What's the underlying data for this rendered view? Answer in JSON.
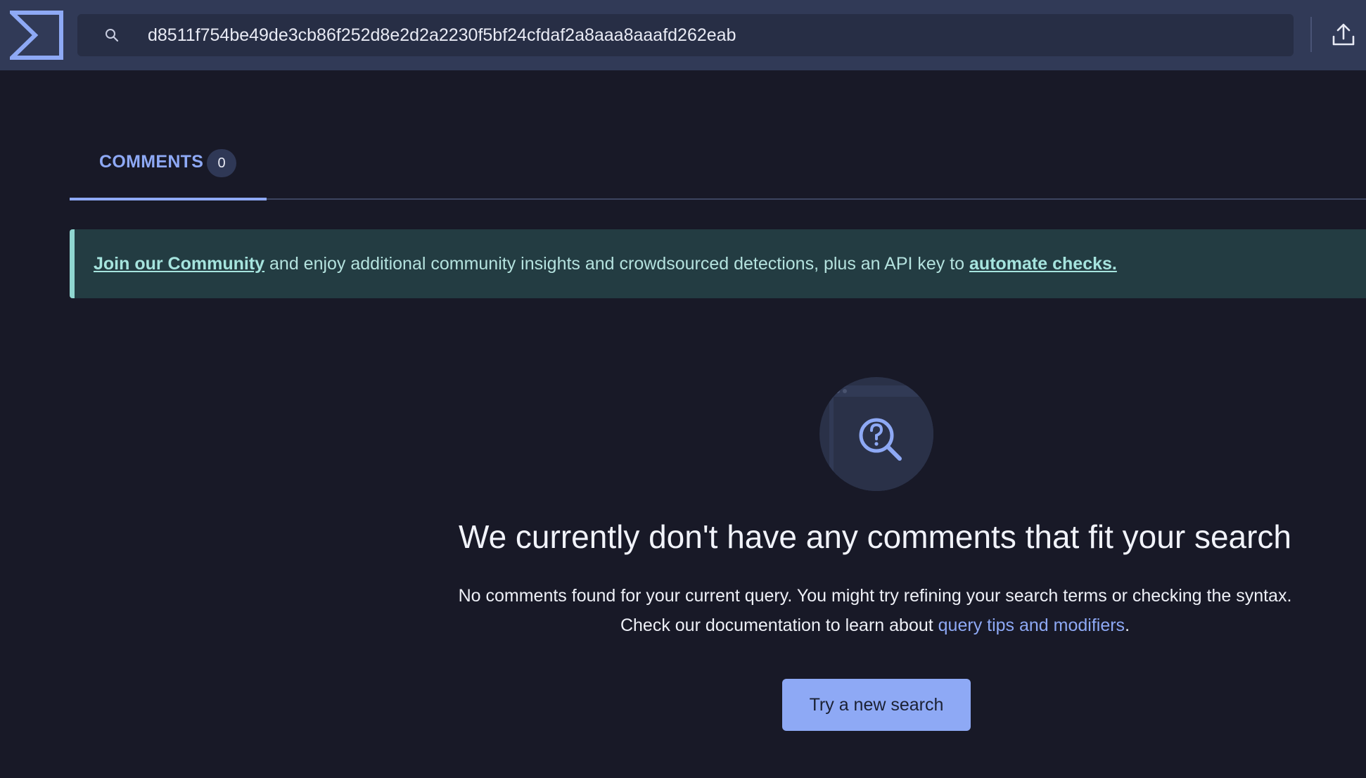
{
  "header": {
    "search": {
      "value": "d8511f754be49de3cb86f252d8e2d2a2230f5bf24cfdaf2a8aaa8aaafd262eab",
      "placeholder": ""
    },
    "logo_icon": "sigma-logo-icon",
    "upload_icon": "upload-icon"
  },
  "tabs": [
    {
      "label": "COMMENTS",
      "count": "0",
      "active": true
    }
  ],
  "banner": {
    "link_community": "Join our Community",
    "middle_text": " and enjoy additional community insights and crowdsourced detections, plus an API key to ",
    "link_automate": "automate checks."
  },
  "empty_state": {
    "icon": "search-question-icon",
    "title": "We currently don't have any comments that fit your search",
    "line1": "No comments found for your current query. You might try refining your search terms or checking the syntax.",
    "line2_prefix": "Check our documentation to learn about ",
    "line2_link": "query tips and modifiers",
    "line2_suffix": ".",
    "button_label": "Try a new search"
  },
  "colors": {
    "background": "#181927",
    "topbar": "#313a57",
    "accent": "#8ea9f5",
    "banner_bg": "#233c42",
    "banner_accent": "#8fd6d0"
  }
}
